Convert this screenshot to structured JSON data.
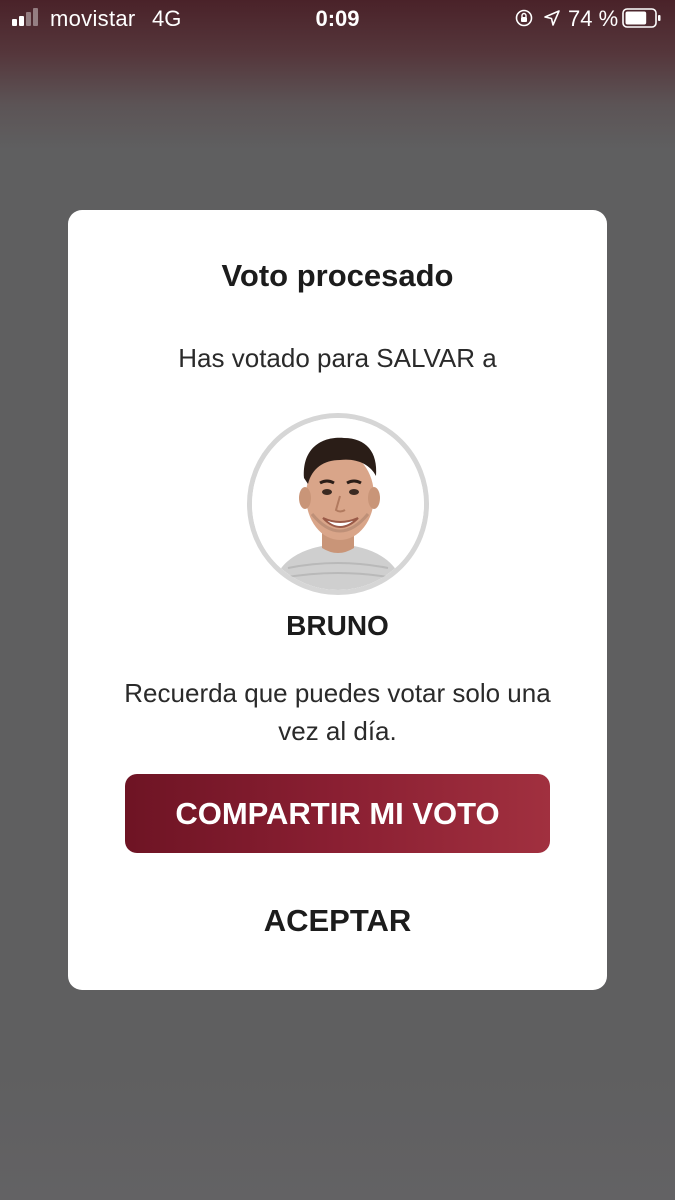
{
  "status_bar": {
    "carrier": "movistar",
    "network": "4G",
    "time": "0:09",
    "battery_percent": "74 %",
    "battery_level": 0.74,
    "signal_bars_active": 2,
    "signal_bars_total": 4,
    "icons": [
      "rotation-lock-icon",
      "location-arrow-icon",
      "battery-icon"
    ]
  },
  "dialog": {
    "title": "Voto procesado",
    "subtitle": "Has votado para SALVAR a",
    "contestant_name": "BRUNO",
    "reminder": "Recuerda que puedes votar solo una vez al día.",
    "share_label": "COMPARTIR MI VOTO",
    "accept_label": "ACEPTAR"
  },
  "colors": {
    "button_gradient_start": "#6e1424",
    "button_gradient_end": "#a1303f",
    "overlay": "#5f5f60",
    "dialog_background": "#ffffff"
  }
}
